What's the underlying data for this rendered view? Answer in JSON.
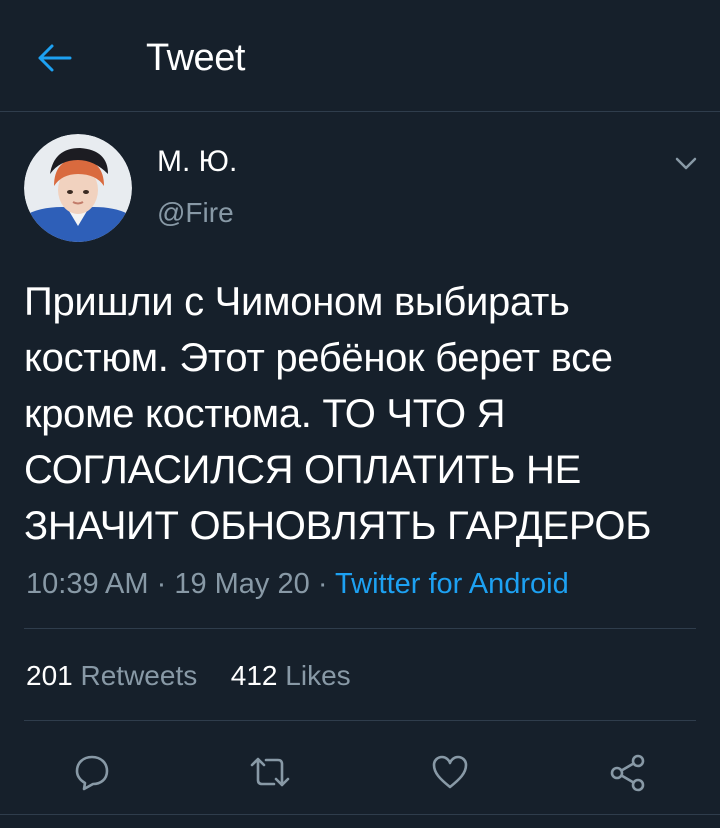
{
  "header": {
    "title": "Tweet",
    "back_icon": "arrow-left-icon",
    "accent_color": "#1da1f2"
  },
  "tweet": {
    "author": {
      "display_name": "М. Ю.",
      "handle": "@Fire"
    },
    "text": "Пришли с Чимоном выбирать костюм. Этот ребёнок берет все кроме костюма. ТО ЧТО Я СОГЛАСИЛСЯ ОПЛАТИТЬ НЕ ЗНАЧИТ ОБНОВЛЯТЬ ГАРДЕРОБ",
    "time": "10:39 AM",
    "date": "19 May 20",
    "separator": "·",
    "source": "Twitter for Android"
  },
  "stats": {
    "retweets_count": "201",
    "retweets_label": "Retweets",
    "likes_count": "412",
    "likes_label": "Likes"
  },
  "actions": {
    "reply_icon": "reply-icon",
    "retweet_icon": "retweet-icon",
    "like_icon": "heart-icon",
    "share_icon": "share-icon"
  },
  "colors": {
    "background": "#16202b",
    "text_primary": "#ffffff",
    "text_secondary": "#8899a6",
    "divider": "#2f3d4c"
  }
}
